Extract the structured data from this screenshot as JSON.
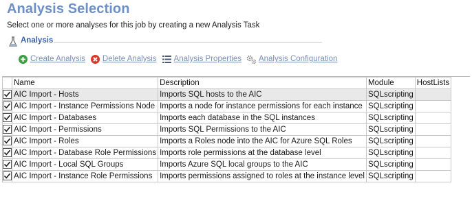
{
  "page": {
    "title": "Analysis Selection",
    "subtitle": "Select one or more analyses for this job by creating a new Analysis Task"
  },
  "section": {
    "label": "Analysis"
  },
  "toolbar": {
    "create_label": "Create Analysis",
    "delete_label": "Delete Analysis",
    "properties_label": "Analysis Properties",
    "configuration_label": "Analysis Configuration"
  },
  "grid": {
    "columns": [
      "",
      "Name",
      "Description",
      "Module",
      "HostLists"
    ],
    "rows": [
      {
        "checked": true,
        "name": "AIC Import - Hosts",
        "description": "Imports SQL hosts to the AIC",
        "module": "SQLscripting",
        "hostlists": ""
      },
      {
        "checked": true,
        "name": "AIC Import - Instance Permissions Node",
        "description": "Imports a node for instance permissions for each instance",
        "module": "SQLscripting",
        "hostlists": ""
      },
      {
        "checked": true,
        "name": "AIC Import - Databases",
        "description": "Imports each database in the SQL instances",
        "module": "SQLscripting",
        "hostlists": ""
      },
      {
        "checked": true,
        "name": "AIC Import - Permissions",
        "description": "Imports SQL Permissions to the AIC",
        "module": "SQLscripting",
        "hostlists": ""
      },
      {
        "checked": true,
        "name": "AIC Import - Roles",
        "description": "Imports a Roles node into the AIC for Azure SQL Roles",
        "module": "SQLscripting",
        "hostlists": ""
      },
      {
        "checked": true,
        "name": "AIC Import - Database Role Permissions",
        "description": "Imports role permissions at the database level",
        "module": "SQLscripting",
        "hostlists": ""
      },
      {
        "checked": true,
        "name": "AIC Import - Local SQL Groups",
        "description": "Imports Azure SQL local groups to the AIC",
        "module": "SQLscripting",
        "hostlists": ""
      },
      {
        "checked": true,
        "name": "AIC Import - Instance Role Permissions",
        "description": "Imports permissions assigned to roles at the instance level",
        "module": "SQLscripting",
        "hostlists": ""
      }
    ]
  },
  "colors": {
    "title": "#6e90c8",
    "section_label": "#3a5fa7",
    "toolbar_link": "#7a8fb5",
    "create_icon": "#3aa040",
    "delete_icon": "#d93a2b",
    "selected_row": "#e9e9e9"
  },
  "icons": {
    "section": "flask-icon",
    "create": "plus-circle-icon",
    "delete": "x-circle-icon",
    "properties": "list-icon",
    "configuration": "gears-icon",
    "row_check": "checkbox-checked-icon"
  }
}
